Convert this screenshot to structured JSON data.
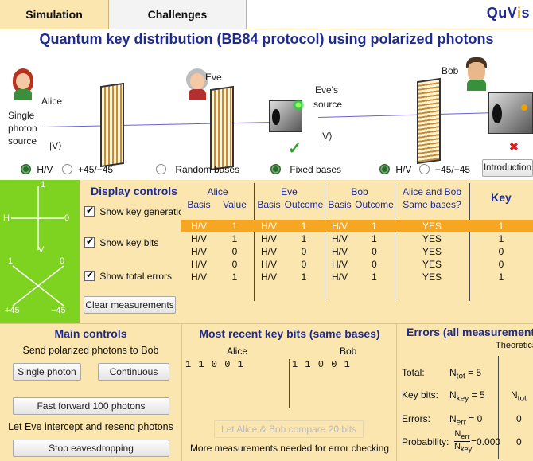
{
  "tabs": {
    "simulation": "Simulation",
    "challenges": "Challenges"
  },
  "logo": {
    "text": "QuVis"
  },
  "title": "Quantum key distribution (BB84 protocol) using polarized photons",
  "scene": {
    "alice": "Alice",
    "source_line1": "Single",
    "source_line2": "photon",
    "source_line3": "source",
    "source_state": "|V⟩",
    "eve": "Eve",
    "eve_source_line1": "Eve's",
    "eve_source_line2": "source",
    "eve_state": "|V⟩",
    "bob": "Bob",
    "check": "✓",
    "cross": "✖"
  },
  "radios": {
    "alice_hv": "H/V",
    "alice_45": "+45/−45",
    "random": "Random bases",
    "fixed": "Fixed bases",
    "bob_hv": "H/V",
    "bob_45": "+45/−45",
    "intro": "Introduction"
  },
  "basis_diagram": {
    "top": "1",
    "h": "H",
    "zero_right": "0",
    "v": "V",
    "one_left": "1",
    "zero_diag": "0",
    "p45": "+45",
    "m45": "−45"
  },
  "display_controls": {
    "title": "Display controls",
    "show_keygen": "Show key generation",
    "show_keybits": "Show key bits",
    "show_errors": "Show total errors",
    "clear": "Clear measurements"
  },
  "table": {
    "alice": "Alice",
    "eve": "Eve",
    "bob": "Bob",
    "same1": "Alice and Bob",
    "same2": "Same bases?",
    "key": "Key",
    "basis": "Basis",
    "value": "Value",
    "outcome": "Outcome",
    "rows": [
      [
        "H/V",
        "1",
        "H/V",
        "1",
        "H/V",
        "1",
        "YES",
        "1"
      ],
      [
        "H/V",
        "1",
        "H/V",
        "1",
        "H/V",
        "1",
        "YES",
        "1"
      ],
      [
        "H/V",
        "0",
        "H/V",
        "0",
        "H/V",
        "0",
        "YES",
        "0"
      ],
      [
        "H/V",
        "0",
        "H/V",
        "0",
        "H/V",
        "0",
        "YES",
        "0"
      ],
      [
        "H/V",
        "1",
        "H/V",
        "1",
        "H/V",
        "1",
        "YES",
        "1"
      ]
    ]
  },
  "main_controls": {
    "title": "Main controls",
    "send": "Send polarized photons to Bob",
    "single": "Single photon",
    "continuous": "Continuous",
    "ff": "Fast forward 100 photons",
    "eve_text": "Let Eve intercept and resend photons",
    "stop": "Stop eavesdropping"
  },
  "recent": {
    "title": "Most recent key bits (same bases)",
    "alice": "Alice",
    "bob": "Bob",
    "alice_bits": "1 1 0 0 1",
    "bob_bits": "1 1 0 0 1",
    "compare": "Let Alice & Bob compare 20 bits",
    "more": "More measurements needed for error checking"
  },
  "errors": {
    "title": "Errors (all measurements)",
    "theoretical": "Theoretical",
    "total": "Total:",
    "n_tot": "N",
    "tot_sub": "tot",
    "tot_val": "= 5",
    "keybits": "Key bits:",
    "key_sub": "key",
    "key_val": "= 5",
    "ntot_col": "N",
    "errors": "Errors:",
    "err_sub": "err",
    "err_val": "= 0",
    "err_theo": "0",
    "prob": "Probability:",
    "prob_val": "=0.000",
    "prob_theo": "0"
  }
}
